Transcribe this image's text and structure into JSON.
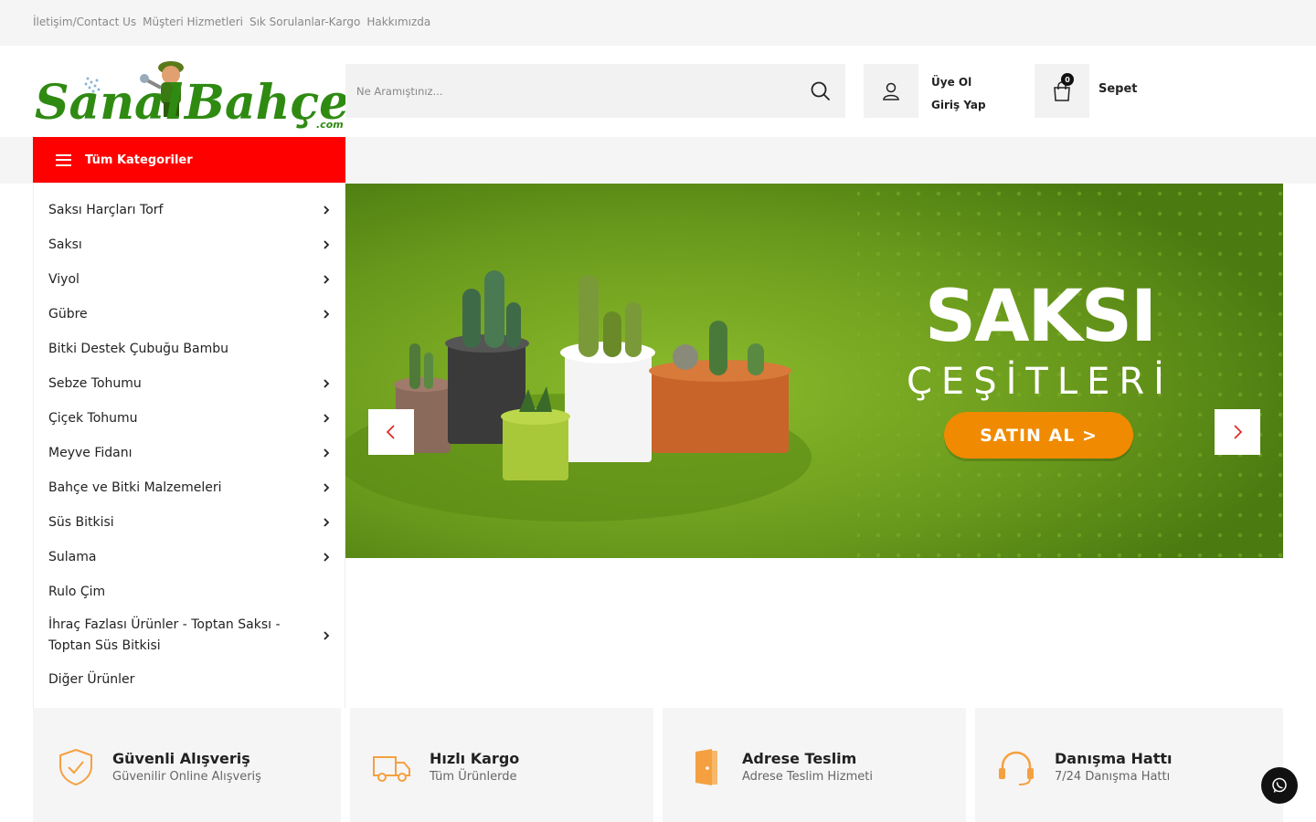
{
  "topbar": {
    "links": [
      "İletişim/Contact Us",
      "Müşteri Hizmetleri",
      "Sık Sorulanlar-Kargo",
      "Hakkımızda"
    ]
  },
  "header": {
    "logo_text_left": "Sanal",
    "logo_text_right": "Bahçem",
    "logo_suffix": ".com",
    "search_placeholder": "Ne Aramıştınız...",
    "user_links": [
      "Üye Ol",
      "Giriş Yap"
    ],
    "cart_count": "0",
    "cart_label": "Sepet"
  },
  "categories": {
    "button_label": "Tüm Kategoriler",
    "items": [
      {
        "label": "Saksı Harçları Torf",
        "has_sub": true
      },
      {
        "label": "Saksı",
        "has_sub": true
      },
      {
        "label": "Viyol",
        "has_sub": true
      },
      {
        "label": "Gübre",
        "has_sub": true
      },
      {
        "label": "Bitki Destek Çubuğu Bambu",
        "has_sub": false
      },
      {
        "label": "Sebze Tohumu",
        "has_sub": true
      },
      {
        "label": "Çiçek Tohumu",
        "has_sub": true
      },
      {
        "label": "Meyve Fidanı",
        "has_sub": true
      },
      {
        "label": "Bahçe ve Bitki Malzemeleri",
        "has_sub": true
      },
      {
        "label": "Süs Bitkisi",
        "has_sub": true
      },
      {
        "label": "Sulama",
        "has_sub": true
      },
      {
        "label": "Rulo Çim",
        "has_sub": false
      },
      {
        "label": "İhraç Fazlası Ürünler - Toptan Saksı - Toptan Süs Bitkisi",
        "has_sub": true
      },
      {
        "label": "Diğer Ürünler",
        "has_sub": false
      }
    ]
  },
  "slider": {
    "title": "SAKSI",
    "subtitle": "ÇEŞİTLERİ",
    "cta": "SATIN AL >"
  },
  "features": [
    {
      "title": "Güvenli Alışveriş",
      "subtitle": "Güvenilir Online Alışveriş",
      "icon": "shield-check-icon"
    },
    {
      "title": "Hızlı Kargo",
      "subtitle": "Tüm Ürünlerde",
      "icon": "truck-icon"
    },
    {
      "title": "Adrese Teslim",
      "subtitle": "Adrese Teslim Hizmeti",
      "icon": "door-icon"
    },
    {
      "title": "Danışma Hattı",
      "subtitle": "7/24 Danışma Hattı",
      "icon": "headset-icon"
    }
  ],
  "colors": {
    "brand_red": "#ff0000",
    "brand_green": "#2f8a12",
    "accent_orange": "#f08a00",
    "banner_green": "#6a9a1c"
  }
}
